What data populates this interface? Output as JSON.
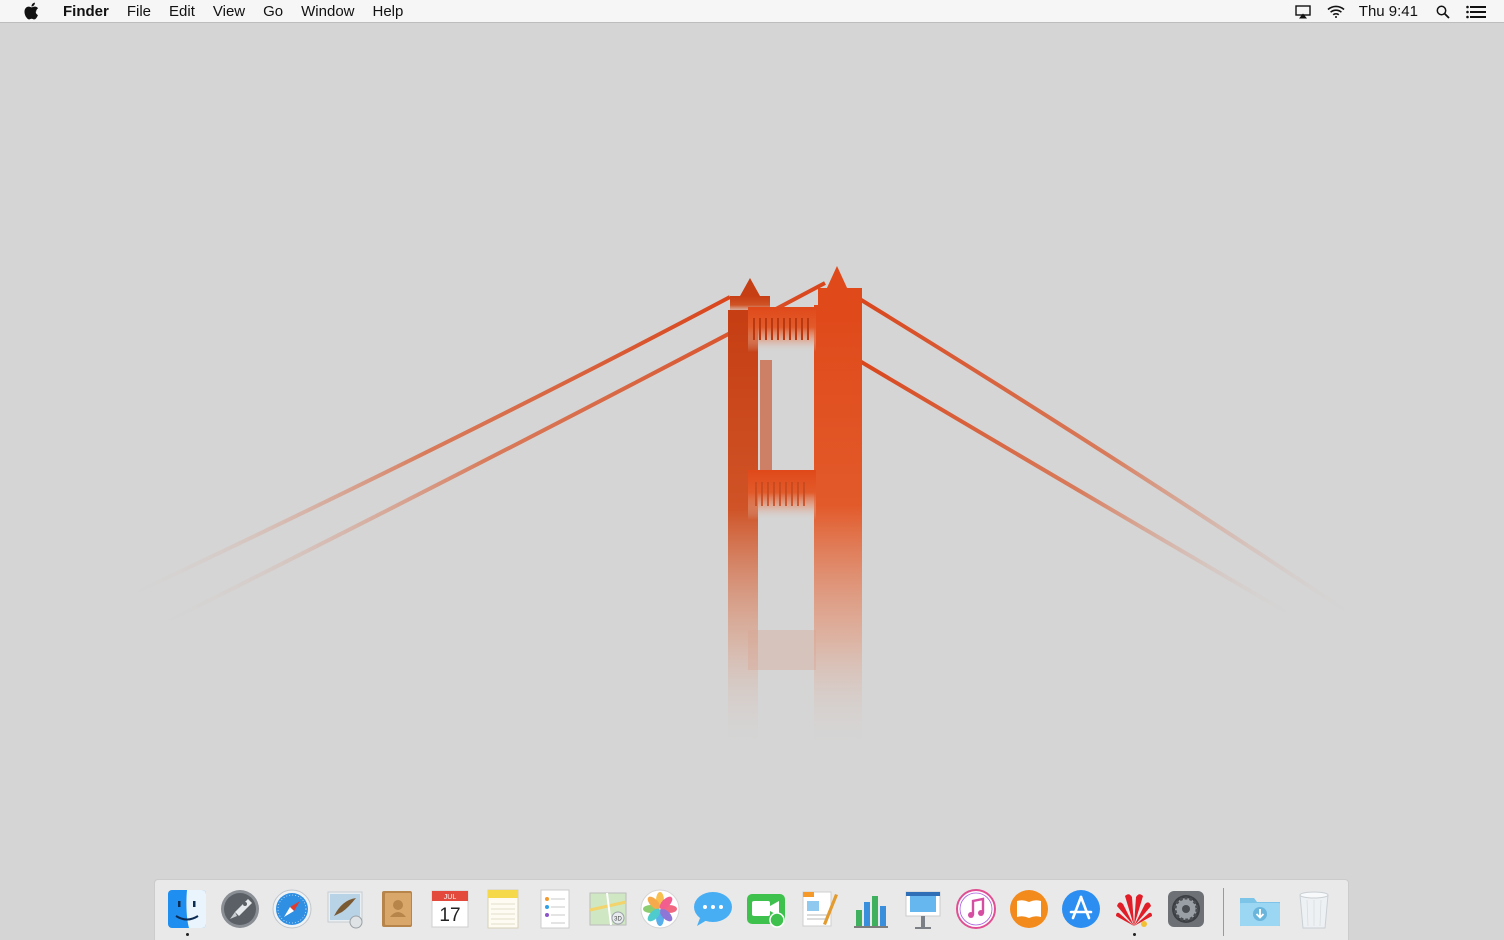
{
  "menubar": {
    "apple_icon": "apple-logo-icon",
    "app_name": "Finder",
    "menus": [
      "File",
      "Edit",
      "View",
      "Go",
      "Window",
      "Help"
    ],
    "status_icons": [
      "airplay-icon",
      "wifi-icon"
    ],
    "clock": "Thu 9:41",
    "right_icons": [
      "spotlight-search-icon",
      "notification-center-icon"
    ]
  },
  "wallpaper": {
    "subject": "golden-gate-bridge-in-fog",
    "bridge_color": "#e2501f",
    "fog_color": "#d5d5d5"
  },
  "dock": {
    "apps": [
      {
        "name": "Finder",
        "icon": "finder-icon",
        "running": true
      },
      {
        "name": "Launchpad",
        "icon": "launchpad-icon",
        "running": false
      },
      {
        "name": "Safari",
        "icon": "safari-icon",
        "running": false
      },
      {
        "name": "Mail",
        "icon": "mail-icon",
        "running": false
      },
      {
        "name": "Contacts",
        "icon": "contacts-icon",
        "running": false
      },
      {
        "name": "Calendar",
        "icon": "calendar-icon",
        "running": false,
        "month": "JUL",
        "day": "17"
      },
      {
        "name": "Notes",
        "icon": "notes-icon",
        "running": false
      },
      {
        "name": "Reminders",
        "icon": "reminders-icon",
        "running": false
      },
      {
        "name": "Maps",
        "icon": "maps-icon",
        "running": false
      },
      {
        "name": "Photos",
        "icon": "photos-icon",
        "running": false
      },
      {
        "name": "Messages",
        "icon": "messages-icon",
        "running": false
      },
      {
        "name": "FaceTime",
        "icon": "facetime-icon",
        "running": false
      },
      {
        "name": "Pages",
        "icon": "pages-icon",
        "running": false
      },
      {
        "name": "Numbers",
        "icon": "numbers-icon",
        "running": false
      },
      {
        "name": "Keynote",
        "icon": "keynote-icon",
        "running": false
      },
      {
        "name": "iTunes",
        "icon": "itunes-icon",
        "running": false
      },
      {
        "name": "iBooks",
        "icon": "ibooks-icon",
        "running": false
      },
      {
        "name": "App Store",
        "icon": "app-store-icon",
        "running": false
      },
      {
        "name": "Huawei",
        "icon": "huawei-icon",
        "running": true
      },
      {
        "name": "System Preferences",
        "icon": "system-preferences-icon",
        "running": false
      }
    ],
    "stacks": [
      {
        "name": "Downloads",
        "icon": "downloads-folder-icon"
      },
      {
        "name": "Trash",
        "icon": "trash-icon"
      }
    ]
  }
}
